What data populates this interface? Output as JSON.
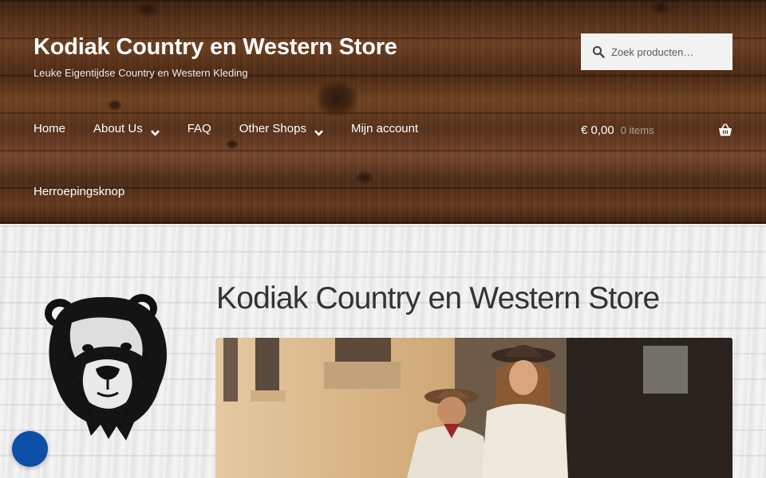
{
  "site": {
    "title": "Kodiak Country en Western Store",
    "tagline": "Leuke Eigentijdse Country en Western Kleding"
  },
  "search": {
    "placeholder": "Zoek producten…",
    "icon": "search-icon"
  },
  "nav": {
    "items": [
      {
        "label": "Home",
        "has_dropdown": false
      },
      {
        "label": "About Us",
        "has_dropdown": true
      },
      {
        "label": "FAQ",
        "has_dropdown": false
      },
      {
        "label": "Other Shops",
        "has_dropdown": true
      },
      {
        "label": "Mijn account",
        "has_dropdown": false
      },
      {
        "label": "Herroepingsknop",
        "has_dropdown": false
      }
    ]
  },
  "cart": {
    "total": "€ 0,00",
    "count_label": "0 items",
    "icon": "basket-icon"
  },
  "main": {
    "heading": "Kodiak Country en Western Store",
    "logo_icon": "bear-head-logo",
    "hero_image": "western-couple-photo"
  },
  "colors": {
    "header_wood": "#5a341c",
    "chat_bubble": "#0c4fa6",
    "heading_text": "#333333"
  }
}
